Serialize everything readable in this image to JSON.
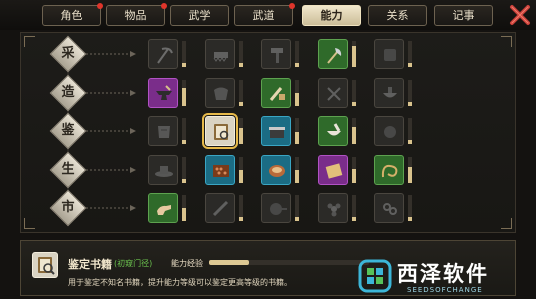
{
  "tabs": [
    {
      "label": "角色",
      "badge": true
    },
    {
      "label": "物品",
      "badge": true
    },
    {
      "label": "武学",
      "badge": false
    },
    {
      "label": "武道",
      "badge": true
    },
    {
      "label": "能力",
      "badge": false,
      "active": true
    },
    {
      "label": "关系",
      "badge": false
    },
    {
      "label": "记事",
      "badge": false
    }
  ],
  "categories": [
    {
      "label": "采",
      "slots": [
        {
          "rarity": "locked",
          "icon": "scythe-icon"
        },
        {
          "rarity": "locked",
          "icon": "saw-icon"
        },
        {
          "rarity": "locked",
          "icon": "hammer-icon"
        },
        {
          "rarity": "green",
          "icon": "axe-icon"
        },
        {
          "rarity": "locked",
          "icon": "empty-icon"
        }
      ]
    },
    {
      "label": "造",
      "slots": [
        {
          "rarity": "purple",
          "icon": "anvil-icon"
        },
        {
          "rarity": "locked",
          "icon": "cloth-icon"
        },
        {
          "rarity": "green",
          "icon": "brush-icon"
        },
        {
          "rarity": "locked",
          "icon": "tools-icon"
        },
        {
          "rarity": "locked",
          "icon": "bowl-icon"
        }
      ]
    },
    {
      "label": "鉴",
      "slots": [
        {
          "rarity": "locked",
          "icon": "armor-icon"
        },
        {
          "rarity": "white",
          "icon": "book-icon",
          "selected": true
        },
        {
          "rarity": "blue",
          "icon": "pot-icon"
        },
        {
          "rarity": "green",
          "icon": "mortar-icon"
        },
        {
          "rarity": "locked",
          "icon": "bead-icon"
        }
      ]
    },
    {
      "label": "生",
      "slots": [
        {
          "rarity": "locked",
          "icon": "hat-icon"
        },
        {
          "rarity": "blue",
          "icon": "abacus-icon"
        },
        {
          "rarity": "blue",
          "icon": "basket-icon"
        },
        {
          "rarity": "purple",
          "icon": "scroll-icon"
        },
        {
          "rarity": "green",
          "icon": "whip-icon"
        }
      ]
    },
    {
      "label": "市",
      "slots": [
        {
          "rarity": "green",
          "icon": "hand-icon"
        },
        {
          "rarity": "locked",
          "icon": "knife-icon"
        },
        {
          "rarity": "locked",
          "icon": "pan-icon"
        },
        {
          "rarity": "locked",
          "icon": "flower-icon"
        },
        {
          "rarity": "locked",
          "icon": "chain-icon"
        }
      ]
    }
  ],
  "meters": [
    [
      0.15,
      0.15,
      0.15,
      0.8,
      0.15
    ],
    [
      0.7,
      0.15,
      0.5,
      0.15,
      0.15
    ],
    [
      0.15,
      0.6,
      0.45,
      0.65,
      0.15
    ],
    [
      0.15,
      0.5,
      0.5,
      0.55,
      0.6
    ],
    [
      0.5,
      0.15,
      0.15,
      0.15,
      0.15
    ]
  ],
  "selected_skill": {
    "name": "鉴定书籍",
    "level": "(初窥门径)",
    "exp_label": "能力经验",
    "exp_fraction": 0.25,
    "description": "用于鉴定不知名书籍，提升能力等级可以鉴定更高等级的书籍。"
  },
  "watermark": {
    "title": "西泽软件",
    "subtitle": "SEEDSOFCHANGE"
  },
  "colors": {
    "accent": "#e6b94a",
    "close": "#c9403a"
  }
}
